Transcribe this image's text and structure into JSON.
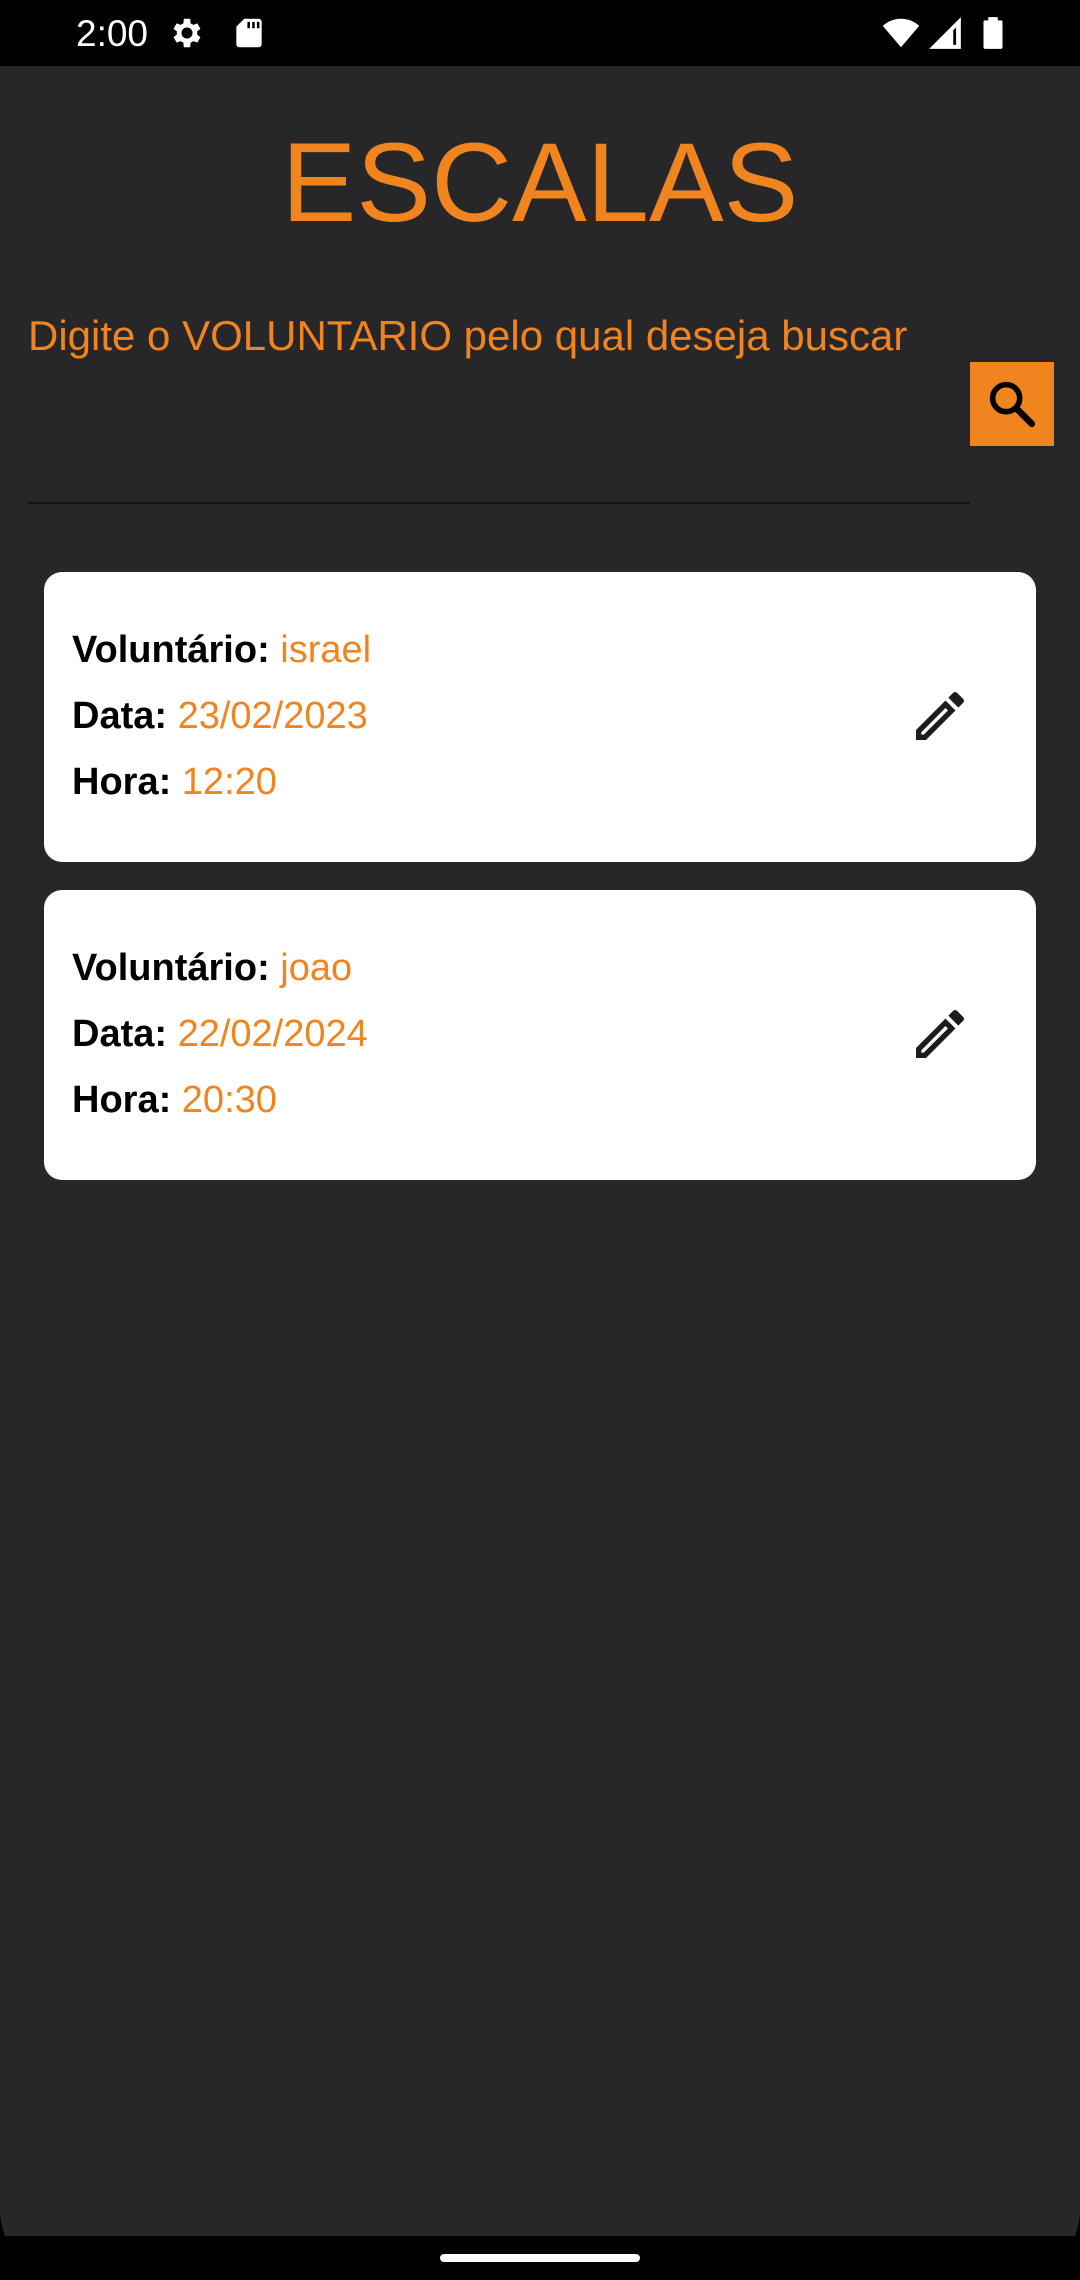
{
  "status_bar": {
    "time": "2:00",
    "icons": [
      "gear-icon",
      "sd-card-icon",
      "wifi-icon",
      "cell-signal-icon",
      "battery-icon"
    ]
  },
  "header": {
    "title": "ESCALAS"
  },
  "search": {
    "placeholder": "Digite o VOLUNTARIO pelo qual deseja buscar",
    "value": "",
    "button_icon": "search-icon"
  },
  "schedules": [
    {
      "volunteer_label": "Voluntário:",
      "volunteer": "israel",
      "date_label": "Data:",
      "date": "23/02/2023",
      "time_label": "Hora:",
      "time": "12:20",
      "action_icon": "edit-icon"
    },
    {
      "volunteer_label": "Voluntário:",
      "volunteer": "joao",
      "date_label": "Data:",
      "date": "22/02/2024",
      "time_label": "Hora:",
      "time": "20:30",
      "action_icon": "edit-icon"
    }
  ],
  "colors": {
    "accent": "#f0841f",
    "background": "#272729",
    "card": "#ffffff"
  }
}
